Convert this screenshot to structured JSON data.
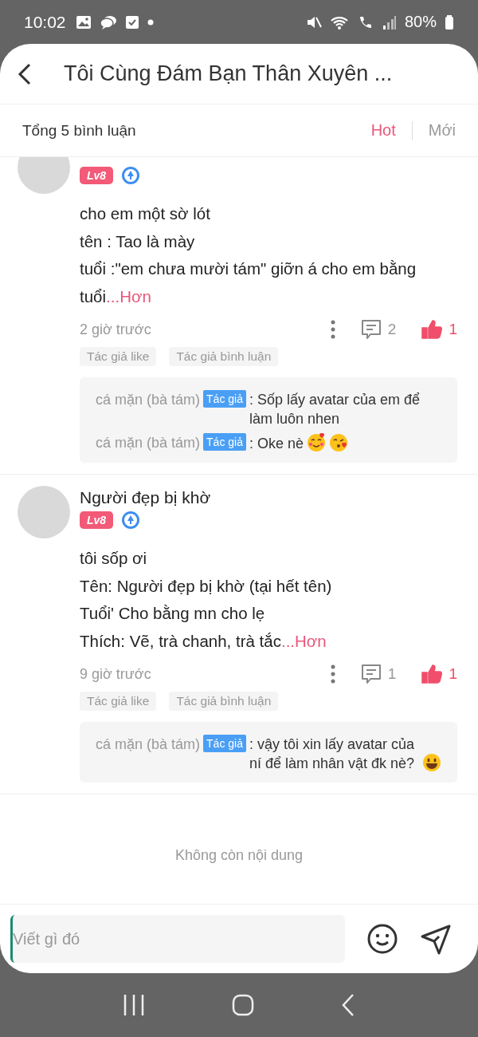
{
  "status_bar": {
    "time": "10:02",
    "battery": "80%"
  },
  "header": {
    "title": "Tôi Cùng Đám Bạn Thân Xuyên ..."
  },
  "sort_bar": {
    "total": "Tổng 5 bình luận",
    "tabs": [
      {
        "label": "Hot",
        "selected": true
      },
      {
        "label": "Mới",
        "selected": false
      }
    ]
  },
  "comments": [
    {
      "level": "Lv8",
      "body": "cho em một sờ lót\ntên : Tao là mày\ntuổi :\"em chưa mười tám\" giỡn á cho em bằng\ntuổi",
      "more": "...Hơn",
      "time": "2 giờ trước",
      "reply_count": "2",
      "like_count": "1",
      "liked": true,
      "tags": [
        "Tác giả like",
        "Tác giả bình luận"
      ],
      "replies": [
        {
          "author": "cá mặn (bà tám)",
          "badge": "Tác giả",
          "text": ": Sốp lấy avatar của em để làm luôn nhen"
        },
        {
          "author": "cá mặn (bà tám)",
          "badge": "Tác giả",
          "text": ": Oke nè",
          "emoji": [
            {
              "kind": "hearts"
            },
            {
              "kind": "kiss"
            }
          ]
        }
      ]
    },
    {
      "author": "Người đẹp bị khờ",
      "level": "Lv8",
      "body": "tôi sốp ơi\nTên: Người đẹp bị khờ (tại hết tên)\nTuổi' Cho bằng mn cho lẹ\nThích: Vẽ, trà chanh, trà tắc",
      "more": "...Hơn",
      "time": "9 giờ trước",
      "reply_count": "1",
      "like_count": "1",
      "liked": true,
      "tags": [
        "Tác giả like",
        "Tác giả bình luận"
      ],
      "replies": [
        {
          "author": "cá mặn (bà tám)",
          "badge": "Tác giả",
          "text": ": vậy tôi xin lấy avatar của ní để làm nhân vật đk nè?",
          "emoji": [
            {
              "kind": "grin"
            }
          ]
        }
      ]
    }
  ],
  "end_note": "Không còn nội dung",
  "composer": {
    "placeholder": "Viết gì đó"
  }
}
